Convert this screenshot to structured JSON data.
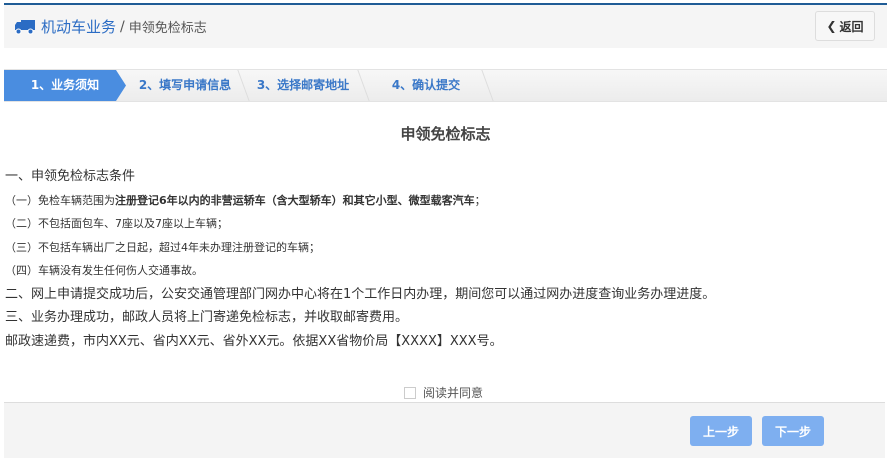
{
  "header": {
    "title": "机动车业务",
    "separator": "/",
    "subtitle": "申领免检标志",
    "back_label": "返回"
  },
  "steps": [
    {
      "label": "1、业务须知",
      "active": true
    },
    {
      "label": "2、填写申请信息"
    },
    {
      "label": "3、选择邮寄地址"
    },
    {
      "label": "4、确认提交"
    }
  ],
  "page_title": "申领免检标志",
  "content": {
    "section1": "一、申领免检标志条件",
    "item1": {
      "prefix": "（一）免检车辆范围为",
      "bold": "注册登记6年以内的非营运轿车（含大型轿车）和其它小型、微型载客汽车",
      "suffix": "；"
    },
    "item2": "（二）不包括面包车、7座以及7座以上车辆；",
    "item3": "（三）不包括车辆出厂之日起，超过4年未办理注册登记的车辆；",
    "item4": "（四）车辆没有发生任何伤人交通事故。",
    "section2": "二、网上申请提交成功后，公安交通管理部门网办中心将在1个工作日内办理，期间您可以通过网办进度查询业务办理进度。",
    "section3": "三、业务办理成功，邮政人员将上门寄递免检标志，并收取邮寄费用。",
    "fee": "邮政速递费，市内XX元、省内XX元、省外XX元。依据XX省物价局【XXXX】XXX号。"
  },
  "agree_label": "阅读并同意",
  "buttons": {
    "prev": "上一步",
    "next": "下一步"
  },
  "colors": {
    "accent": "#4a8de0",
    "button": "#7eaff0",
    "topline": "#1f5c96"
  }
}
